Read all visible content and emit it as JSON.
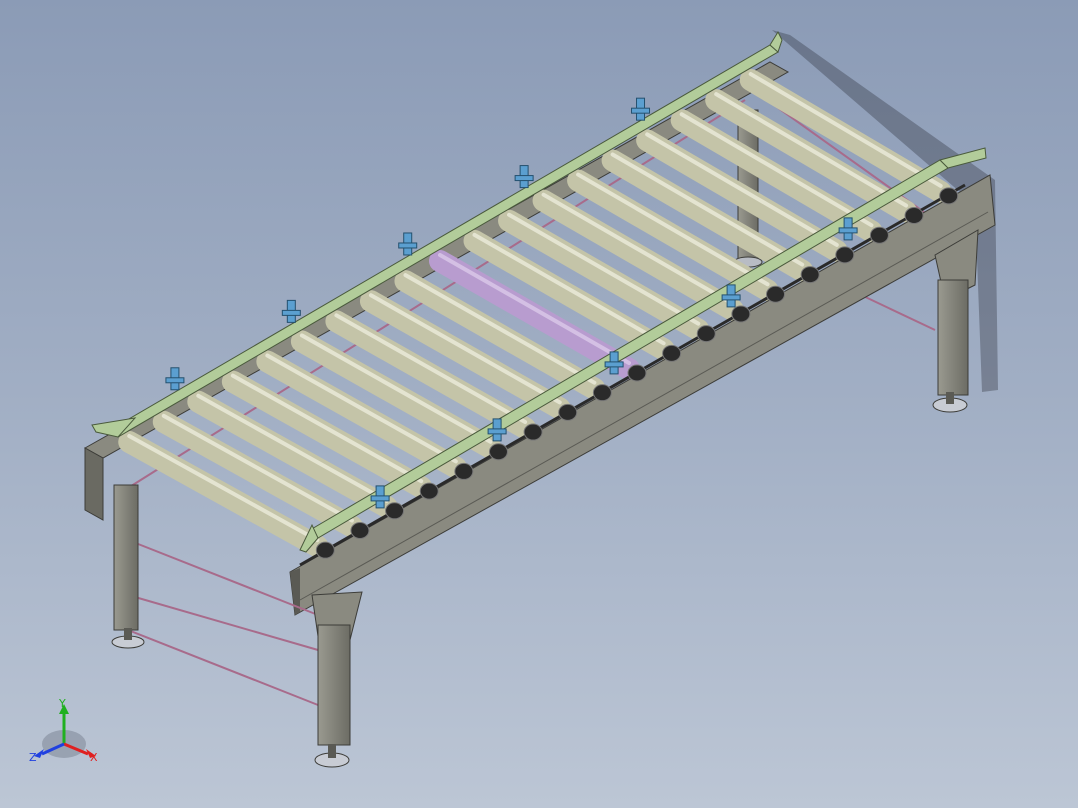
{
  "viewport": {
    "background_top": "#8b9bb6",
    "background_bottom": "#bcc6d5"
  },
  "model": {
    "roller_count": 19,
    "highlighted_roller_index": 9,
    "support_leg_pairs": 2,
    "cross_brace_rods": 3,
    "guide_rail_brackets_per_side": 5,
    "colors": {
      "roller": "#c4c4a8",
      "roller_highlight": "#b89ccf",
      "frame": "#8a8a80",
      "frame_dark": "#5a5a54",
      "guide_rail": "#b2cc9a",
      "bracket": "#5b9fd0",
      "brace_rod": "#a86b8b",
      "chain": "#2a2a2a"
    }
  },
  "triad": {
    "x_label": "X",
    "y_label": "Y",
    "z_label": "Z",
    "x_color": "#e02020",
    "y_color": "#20b020",
    "z_color": "#2040e0"
  }
}
